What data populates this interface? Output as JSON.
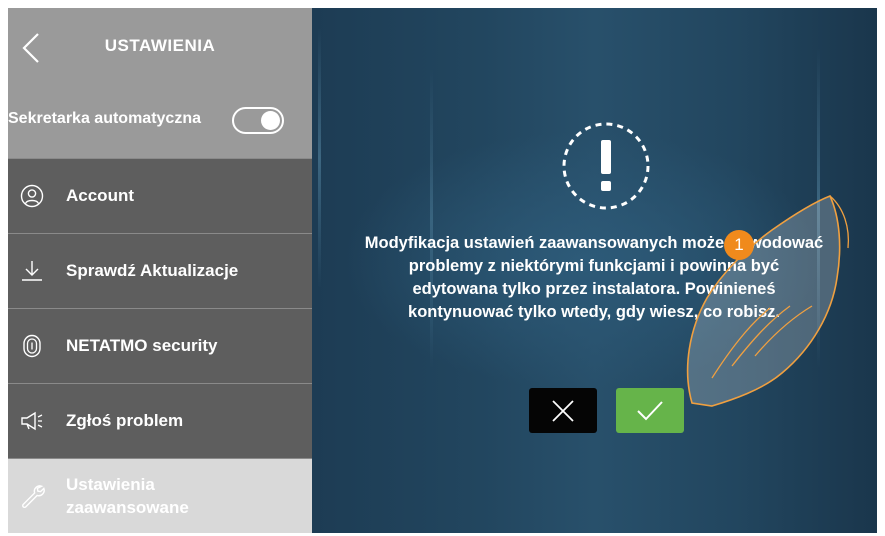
{
  "header": {
    "title": "USTAWIENIA"
  },
  "toggle_row": {
    "label": "Sekretarka automatyczna",
    "enabled": true
  },
  "sidebar": {
    "items": [
      {
        "label": "Account",
        "icon": "user-icon"
      },
      {
        "label": "Sprawdź Aktualizacje",
        "icon": "download-icon"
      },
      {
        "label": "NETATMO security",
        "icon": "fingerprint-icon"
      },
      {
        "label": "Zgłoś problem",
        "icon": "megaphone-icon"
      },
      {
        "label": "Ustawienia zaawansowane",
        "icon": "wrench-icon",
        "active": true
      }
    ]
  },
  "dialog": {
    "icon": "warning-icon",
    "message": "Modyfikacja ustawień zaawansowanych może powodować problemy z niektórymi funkcjami i powinna być edytowana tylko przez instalatora. Powinieneś kontynuować tylko wtedy, gdy wiesz, co robisz.",
    "cancel_icon": "close-icon",
    "confirm_icon": "check-icon"
  },
  "step_badge": "1",
  "colors": {
    "sidebar_header": "#9a9a9a",
    "sidebar_bg": "#5e5e5e",
    "active_item": "#d9d9d9",
    "confirm": "#66b44a",
    "cancel": "#050505",
    "badge": "#f08a1c"
  }
}
